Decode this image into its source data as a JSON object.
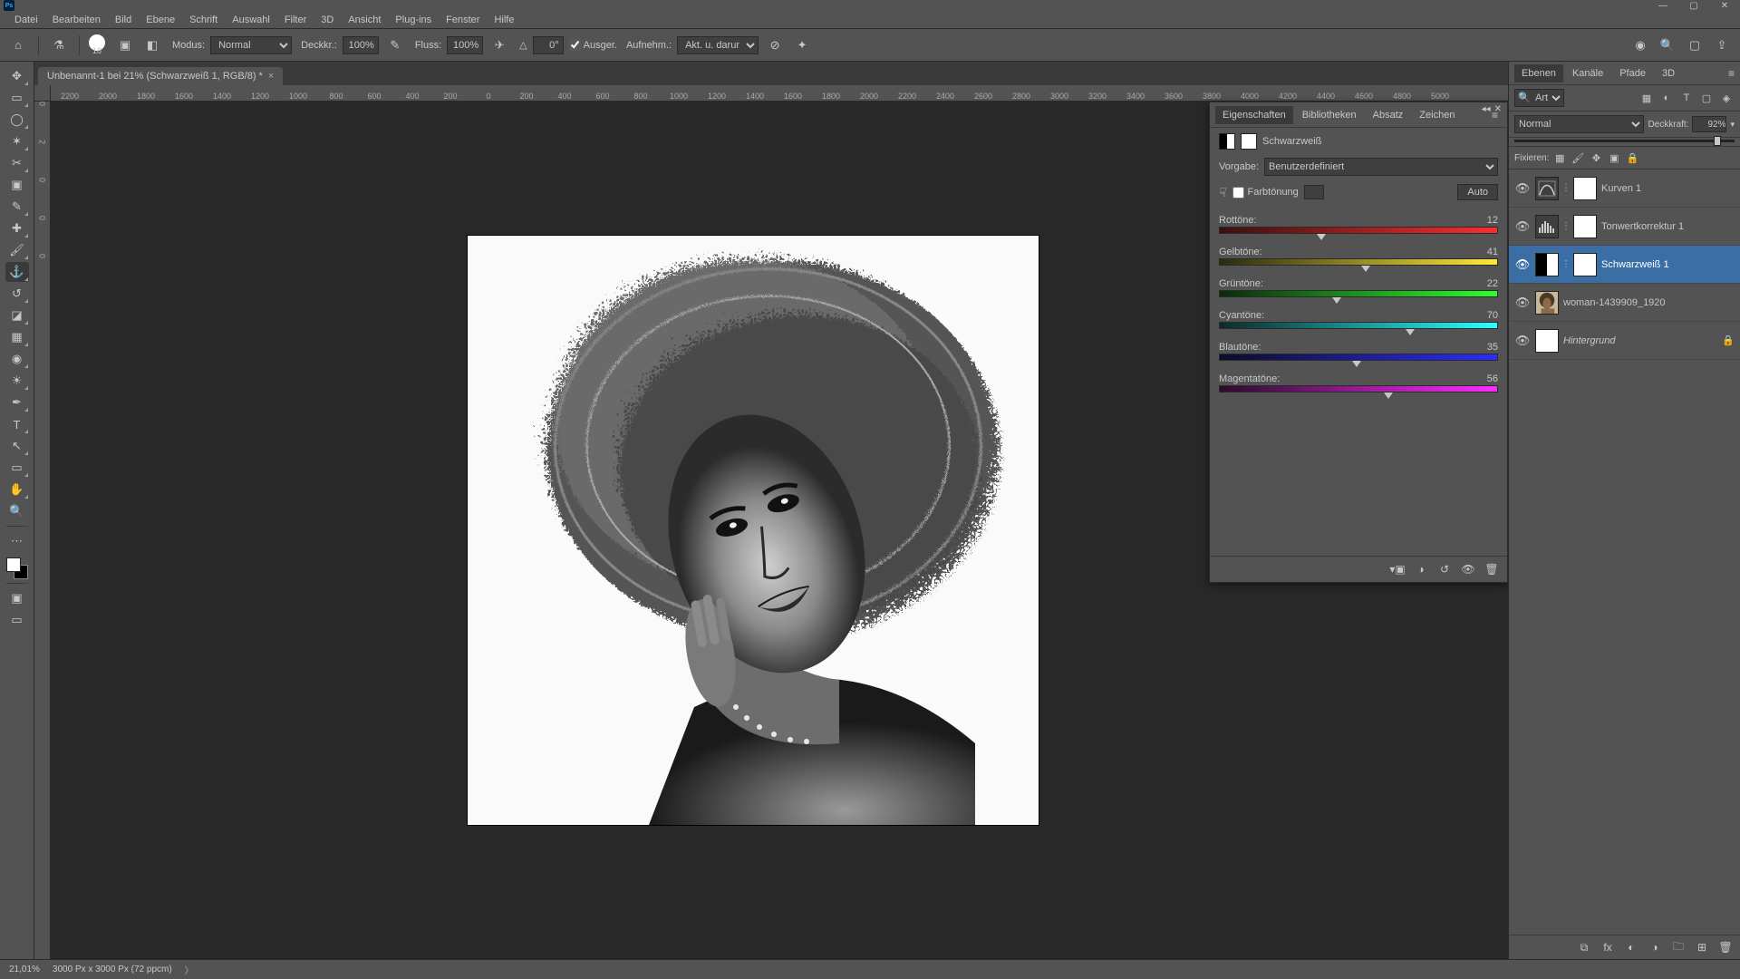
{
  "window": {
    "title": "Adobe Photoshop"
  },
  "menu": [
    "Datei",
    "Bearbeiten",
    "Bild",
    "Ebene",
    "Schrift",
    "Auswahl",
    "Filter",
    "3D",
    "Ansicht",
    "Plug-ins",
    "Fenster",
    "Hilfe"
  ],
  "options": {
    "brush_size": "18",
    "mode_label": "Modus:",
    "mode_value": "Normal",
    "opacity_label": "Deckkr.:",
    "opacity_value": "100%",
    "flow_label": "Fluss:",
    "flow_value": "100%",
    "angle_label": "△",
    "angle_value": "0°",
    "ausger_label": "Ausger.",
    "sample_label": "Aufnehm.:",
    "sample_value": "Akt. u. darunter"
  },
  "doc_tab": {
    "title": "Unbenannt-1 bei 21% (Schwarzweiß 1, RGB/8) *"
  },
  "ruler_h": [
    "2200",
    "2000",
    "1800",
    "1600",
    "1400",
    "1200",
    "1000",
    "800",
    "600",
    "400",
    "200",
    "0",
    "200",
    "400",
    "600",
    "800",
    "1000",
    "1200",
    "1400",
    "1600",
    "1800",
    "2000",
    "2200",
    "2400",
    "2600",
    "2800",
    "3000",
    "3200",
    "3400",
    "3600",
    "3800",
    "4000",
    "4200",
    "4400",
    "4600",
    "4800",
    "5000"
  ],
  "ruler_v": [
    "0",
    "2",
    "0",
    "0",
    "0"
  ],
  "properties": {
    "tabs": [
      "Eigenschaften",
      "Bibliotheken",
      "Absatz",
      "Zeichen"
    ],
    "title": "Schwarzweiß",
    "preset_label": "Vorgabe:",
    "preset_value": "Benutzerdefiniert",
    "tint_label": "Farbtönung",
    "auto_label": "Auto",
    "sliders": [
      {
        "name": "Rottöne:",
        "value": 12,
        "grad": "grad-red"
      },
      {
        "name": "Gelbtöne:",
        "value": 41,
        "grad": "grad-yellow"
      },
      {
        "name": "Grüntöne:",
        "value": 22,
        "grad": "grad-green"
      },
      {
        "name": "Cyantöne:",
        "value": 70,
        "grad": "grad-cyan"
      },
      {
        "name": "Blautöne:",
        "value": 35,
        "grad": "grad-blue"
      },
      {
        "name": "Magentatöne:",
        "value": 56,
        "grad": "grad-mag"
      }
    ]
  },
  "layers_panel": {
    "tabs": [
      "Ebenen",
      "Kanäle",
      "Pfade",
      "3D"
    ],
    "filter_value": "Art",
    "blend_mode": "Normal",
    "opacity_label": "Deckkraft:",
    "opacity_value": "92%",
    "opacity_pct": 92,
    "lock_label": "Fixieren:",
    "layers": [
      {
        "kind": "adj",
        "icon": "∿",
        "name": "Kurven 1",
        "selected": false
      },
      {
        "kind": "adj",
        "icon": "▮",
        "name": "Tonwertkorrektur 1",
        "selected": false,
        "histo": true
      },
      {
        "kind": "adj",
        "icon": "◐",
        "name": "Schwarzweiß 1",
        "selected": true,
        "bw": true
      },
      {
        "kind": "img",
        "name": "woman-1439909_1920",
        "selected": false
      },
      {
        "kind": "bg",
        "name": "Hintergrund",
        "selected": false,
        "locked": true
      }
    ]
  },
  "status": {
    "zoom": "21,01%",
    "doc_info": "3000 Px x 3000 Px (72 ppcm)"
  }
}
